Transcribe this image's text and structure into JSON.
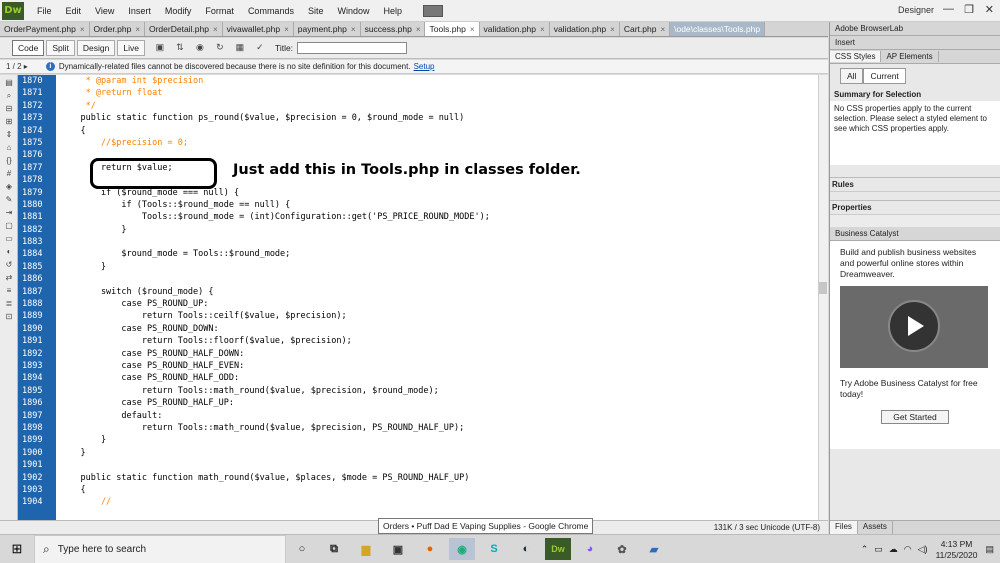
{
  "app": {
    "logo": "Dw",
    "layout": "Designer",
    "win_min": "—",
    "win_max": "❐",
    "win_close": "✕"
  },
  "menu": [
    "File",
    "Edit",
    "View",
    "Insert",
    "Modify",
    "Format",
    "Commands",
    "Site",
    "Window",
    "Help"
  ],
  "tabs": [
    {
      "label": "OrderPayment.php"
    },
    {
      "label": "Order.php"
    },
    {
      "label": "OrderDetail.php"
    },
    {
      "label": "vivawallet.php"
    },
    {
      "label": "payment.php"
    },
    {
      "label": "success.php"
    },
    {
      "label": "Tools.php"
    },
    {
      "label": "validation.php"
    },
    {
      "label": "validation.php"
    },
    {
      "label": "Cart.php"
    },
    {
      "label": "\\ode\\classes\\Tools.php"
    }
  ],
  "toolbar": {
    "code": "Code",
    "split": "Split",
    "design": "Design",
    "live": "Live",
    "title_label": "Title:"
  },
  "infobar": {
    "pager": "1 / 2 ▸",
    "message": "Dynamically-related files cannot be discovered because there is no site definition for this document.",
    "link": "Setup"
  },
  "line_numbers": [
    "1870",
    "1871",
    "1872",
    "1873",
    "1874",
    "1875",
    "1876",
    "1877",
    "1878",
    "1879",
    "1880",
    "1881",
    "1882",
    "1883",
    "1884",
    "1885",
    "1886",
    "1887",
    "1888",
    "1889",
    "1890",
    "1891",
    "1892",
    "1893",
    "1894",
    "1895",
    "1896",
    "1897",
    "1898",
    "1899",
    "1900",
    "1901",
    "1902",
    "1903",
    "1904"
  ],
  "code_lines": [
    {
      "cls": "c",
      "text": "     * @param int $precision"
    },
    {
      "cls": "c",
      "text": "     * @return float"
    },
    {
      "cls": "c",
      "text": "     */"
    },
    {
      "cls": "",
      "text": "    public static function ps_round($value, $precision = 0, $round_mode = null)"
    },
    {
      "cls": "",
      "text": "    {"
    },
    {
      "cls": "c",
      "text": "        //$precision = 0;"
    },
    {
      "cls": "",
      "text": ""
    },
    {
      "cls": "",
      "text": "        return $value;"
    },
    {
      "cls": "",
      "text": ""
    },
    {
      "cls": "",
      "text": "        if ($round_mode === null) {"
    },
    {
      "cls": "",
      "text": "            if (Tools::$round_mode == null) {"
    },
    {
      "cls": "",
      "text": "                Tools::$round_mode = (int)Configuration::get('PS_PRICE_ROUND_MODE');"
    },
    {
      "cls": "",
      "text": "            }"
    },
    {
      "cls": "",
      "text": ""
    },
    {
      "cls": "",
      "text": "            $round_mode = Tools::$round_mode;"
    },
    {
      "cls": "",
      "text": "        }"
    },
    {
      "cls": "",
      "text": ""
    },
    {
      "cls": "",
      "text": "        switch ($round_mode) {"
    },
    {
      "cls": "",
      "text": "            case PS_ROUND_UP:"
    },
    {
      "cls": "",
      "text": "                return Tools::ceilf($value, $precision);"
    },
    {
      "cls": "",
      "text": "            case PS_ROUND_DOWN:"
    },
    {
      "cls": "",
      "text": "                return Tools::floorf($value, $precision);"
    },
    {
      "cls": "",
      "text": "            case PS_ROUND_HALF_DOWN:"
    },
    {
      "cls": "",
      "text": "            case PS_ROUND_HALF_EVEN:"
    },
    {
      "cls": "",
      "text": "            case PS_ROUND_HALF_ODD:"
    },
    {
      "cls": "",
      "text": "                return Tools::math_round($value, $precision, $round_mode);"
    },
    {
      "cls": "",
      "text": "            case PS_ROUND_HALF_UP:"
    },
    {
      "cls": "",
      "text": "            default:"
    },
    {
      "cls": "",
      "text": "                return Tools::math_round($value, $precision, PS_ROUND_HALF_UP);"
    },
    {
      "cls": "",
      "text": "        }"
    },
    {
      "cls": "",
      "text": "    }"
    },
    {
      "cls": "",
      "text": ""
    },
    {
      "cls": "",
      "text": "    public static function math_round($value, $places, $mode = PS_ROUND_HALF_UP)"
    },
    {
      "cls": "",
      "text": "    {"
    },
    {
      "cls": "c",
      "text": "        //"
    }
  ],
  "annotation": "Just add this in Tools.php in classes folder.",
  "status": {
    "right": "131K / 3 sec  Unicode (UTF-8)",
    "tooltip": "Orders • Puff Dad E Vaping Supplies - Google Chrome"
  },
  "panel": {
    "browserlab": "Adobe BrowserLab",
    "insert": "Insert",
    "css_tabs": [
      "CSS Styles",
      "AP Elements"
    ],
    "all": "All",
    "current": "Current",
    "summary_head": "Summary for Selection",
    "summary_text": "No CSS properties apply to the current selection.  Please select a styled element to see which CSS properties apply.",
    "rules": "Rules",
    "properties": "Properties",
    "bc_head": "Business Catalyst",
    "bc_text": "Build and publish business websites and powerful online stores within Dreamweaver.",
    "bc_try": "Try Adobe Business Catalyst for free today!",
    "bc_button": "Get Started",
    "files": "Files",
    "assets": "Assets"
  },
  "taskbar": {
    "search": "Type here to search",
    "time": "4:13 PM",
    "date": "11/25/2020"
  }
}
